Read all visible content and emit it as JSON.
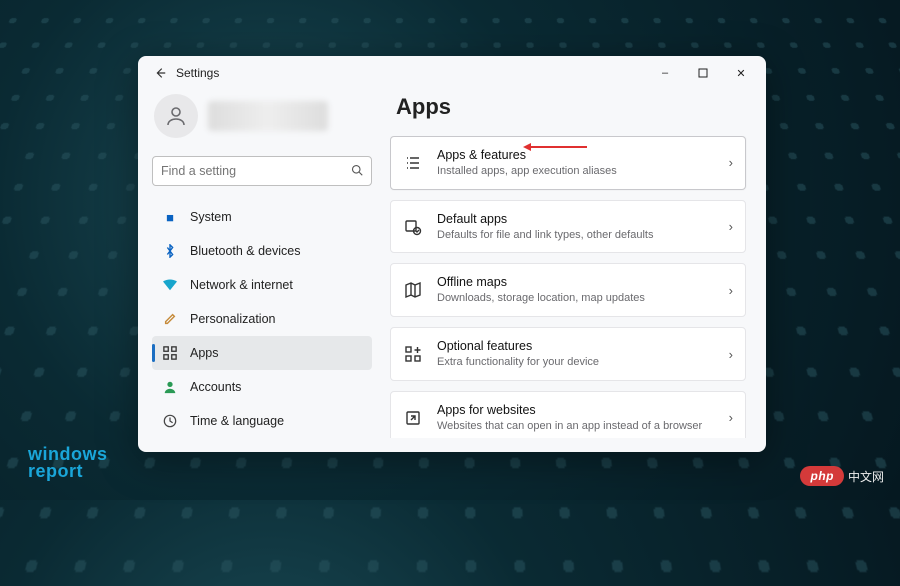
{
  "window": {
    "title": "Settings",
    "controls": {
      "minimize": "–",
      "maximize": "□",
      "close": "✕"
    }
  },
  "user": {
    "name_hidden": true
  },
  "search": {
    "placeholder": "Find a setting"
  },
  "nav": {
    "items": [
      {
        "id": "system",
        "label": "System",
        "icon": "🖥",
        "icon_color": "#0a63c2"
      },
      {
        "id": "bluetooth",
        "label": "Bluetooth & devices",
        "icon": "ᚼ",
        "icon_color": "#0a63c2"
      },
      {
        "id": "network",
        "label": "Network & internet",
        "icon": "📶",
        "icon_color": "#17a5cc"
      },
      {
        "id": "personalization",
        "label": "Personalization",
        "icon": "✎",
        "icon_color": "#c58a3a"
      },
      {
        "id": "apps",
        "label": "Apps",
        "icon": "▦",
        "icon_color": "#333",
        "selected": true
      },
      {
        "id": "accounts",
        "label": "Accounts",
        "icon": "👤",
        "icon_color": "#2a9a55"
      },
      {
        "id": "time",
        "label": "Time & language",
        "icon": "🕓",
        "icon_color": "#444"
      }
    ]
  },
  "page": {
    "title": "Apps",
    "cards": [
      {
        "id": "apps-features",
        "title": "Apps & features",
        "subtitle": "Installed apps, app execution aliases",
        "highlighted": true
      },
      {
        "id": "default-apps",
        "title": "Default apps",
        "subtitle": "Defaults for file and link types, other defaults"
      },
      {
        "id": "offline-maps",
        "title": "Offline maps",
        "subtitle": "Downloads, storage location, map updates"
      },
      {
        "id": "optional-features",
        "title": "Optional features",
        "subtitle": "Extra functionality for your device"
      },
      {
        "id": "apps-websites",
        "title": "Apps for websites",
        "subtitle": "Websites that can open in an app instead of a browser"
      }
    ]
  },
  "watermarks": {
    "windows_report_line1": "windows",
    "windows_report_line2": "report",
    "php_badge": "php",
    "php_cn": "中文网"
  }
}
